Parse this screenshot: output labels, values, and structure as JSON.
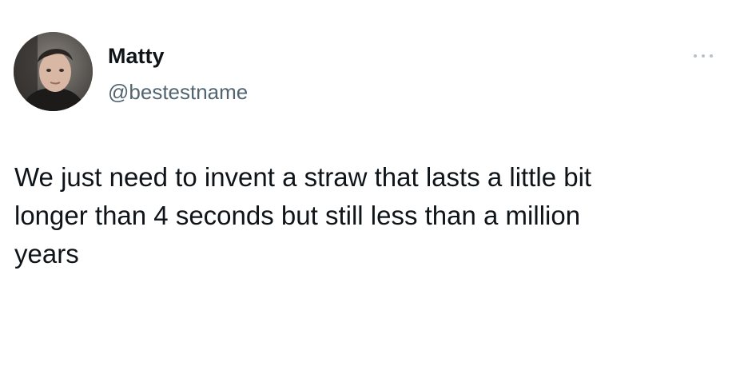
{
  "tweet": {
    "author": {
      "display_name": "Matty",
      "handle": "@bestestname"
    },
    "text": "We just need to invent a straw that lasts a little bit\nlonger than 4 seconds but still less than a million\nyears",
    "more_icon": "more-horizontal-icon"
  },
  "colors": {
    "background": "#ffffff",
    "primary_text": "#0f1419",
    "secondary_text": "#536471",
    "icon_muted": "#b9c1c7"
  }
}
